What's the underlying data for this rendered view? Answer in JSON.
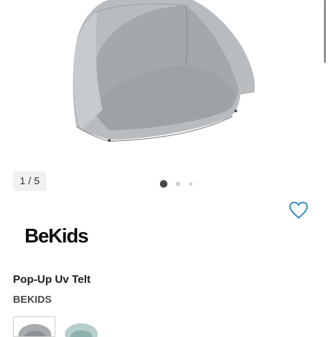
{
  "gallery": {
    "counter": "1 / 5",
    "total_images": 5,
    "current_index": 1
  },
  "product": {
    "brand_logo": "BeKids",
    "title": "Pop-Up Uv Telt",
    "brand": "BEKIDS"
  },
  "icons": {
    "favorite": "heart-outline-icon"
  },
  "colors": {
    "accent": "#2f86c4",
    "tent_grey": "#b9bcbf"
  }
}
